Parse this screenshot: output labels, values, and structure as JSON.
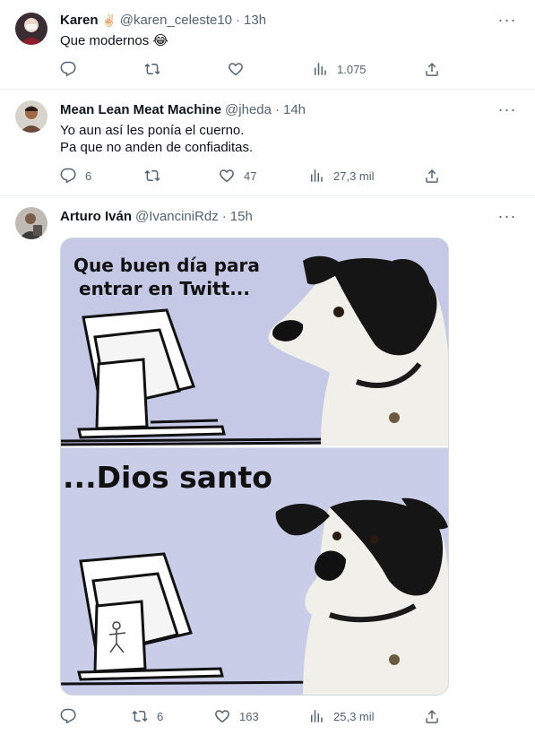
{
  "tweets": [
    {
      "name": "Karen",
      "badge": "✌🏻",
      "handle": "@karen_celeste10",
      "time": "13h",
      "lines": [
        "Que modernos 😂"
      ],
      "reply": "",
      "retweet": "",
      "like": "",
      "views": "1.075"
    },
    {
      "name": "Mean Lean Meat Machine",
      "badge": "",
      "handle": "@jheda",
      "time": "14h",
      "lines": [
        "Yo aun así les ponía el cuerno.",
        "Pa que no anden de confiaditas."
      ],
      "reply": "6",
      "retweet": "",
      "like": "47",
      "views": "27,3 mil"
    },
    {
      "name": "Arturo Iván",
      "badge": "",
      "handle": "@IvanciniRdz",
      "time": "15h",
      "lines": [],
      "reply": "",
      "retweet": "6",
      "like": "163",
      "views": "25,3 mil",
      "meme": {
        "top_text_line1": "Que buen día para",
        "top_text_line2": "entrar en Twitt...",
        "bottom_text": "...Dios santo"
      }
    }
  ],
  "ui": {
    "separator": "·",
    "more_glyph": "···"
  },
  "colors": {
    "secondary": "#536471",
    "meme_bg": "#c9cde8",
    "border": "#eff3f4"
  },
  "icons": [
    "reply-icon",
    "retweet-icon",
    "like-icon",
    "views-icon",
    "share-icon",
    "more-icon"
  ]
}
